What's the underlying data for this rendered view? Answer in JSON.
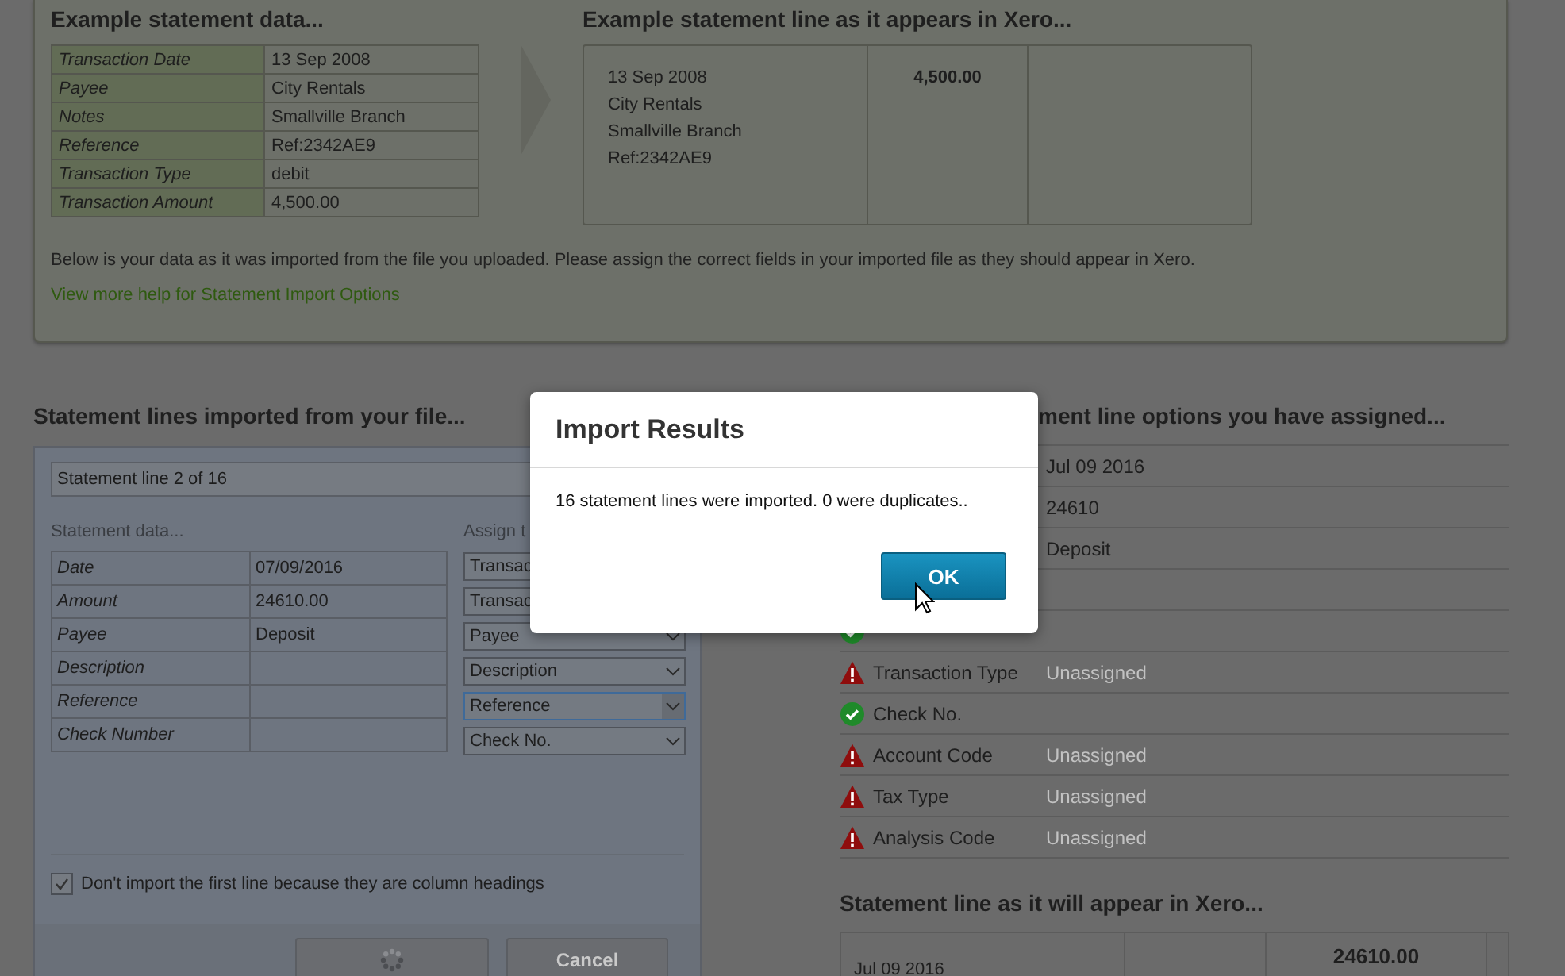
{
  "example_panel": {
    "data_title": "Example statement data...",
    "data_rows": [
      {
        "label": "Transaction Date",
        "value": "13 Sep 2008"
      },
      {
        "label": "Payee",
        "value": "City Rentals"
      },
      {
        "label": "Notes",
        "value": "Smallville Branch"
      },
      {
        "label": "Reference",
        "value": "Ref:2342AE9"
      },
      {
        "label": "Transaction Type",
        "value": "debit"
      },
      {
        "label": "Transaction Amount",
        "value": "4,500.00"
      }
    ],
    "preview_title": "Example statement line as it appears in Xero...",
    "preview_lines": [
      "13 Sep 2008",
      "City Rentals",
      "Smallville Branch",
      "Ref:2342AE9"
    ],
    "preview_amount": "4,500.00",
    "note": "Below is your data as it was imported from the file you uploaded. Please assign the correct fields in your imported file as they should appear in Xero.",
    "help_link": "View more help for Statement Import Options"
  },
  "imported": {
    "title": "Statement lines imported from your file...",
    "line_selector": "Statement line 2 of 16",
    "data_heading": "Statement data...",
    "assign_heading": "Assign t",
    "rows": [
      {
        "label": "Date",
        "value": "07/09/2016",
        "assigned": "Transac",
        "focused": false
      },
      {
        "label": "Amount",
        "value": "24610.00",
        "assigned": "Transac",
        "focused": false
      },
      {
        "label": "Payee",
        "value": "Deposit",
        "assigned": "Payee",
        "focused": false
      },
      {
        "label": "Description",
        "assigned": "Description",
        "focused": false
      },
      {
        "label": "Reference",
        "assigned": "Reference",
        "focused": true
      },
      {
        "label": "Check Number",
        "assigned": "Check No.",
        "focused": false
      }
    ],
    "skip_header": {
      "label": "Don't import the first line because they are column headings",
      "checked": true
    },
    "buttons": [
      {
        "kind": "loading"
      },
      {
        "kind": "text",
        "label": "Cancel"
      }
    ]
  },
  "options": {
    "title": "ment line options you have assigned...",
    "rows": [
      {
        "value": "Jul 09 2016"
      },
      {
        "value": "24610"
      },
      {
        "value": "Deposit"
      },
      {
        "kind": "blank"
      },
      {
        "kind": "ok"
      },
      {
        "kind": "warning",
        "label": "Transaction Type",
        "value": "Unassigned"
      },
      {
        "kind": "ok",
        "label": "Check No."
      },
      {
        "kind": "warning",
        "label": "Account Code",
        "value": "Unassigned"
      },
      {
        "kind": "warning",
        "label": "Tax Type",
        "value": "Unassigned"
      },
      {
        "kind": "warning",
        "label": "Analysis Code",
        "value": "Unassigned"
      }
    ]
  },
  "preview": {
    "title": "Statement line as it will appear in Xero...",
    "date": "Jul 09 2016",
    "amount": "24610.00"
  },
  "dialog": {
    "title": "Import Results",
    "message": "16 statement lines were imported. 0 were duplicates..",
    "button": "OK"
  }
}
